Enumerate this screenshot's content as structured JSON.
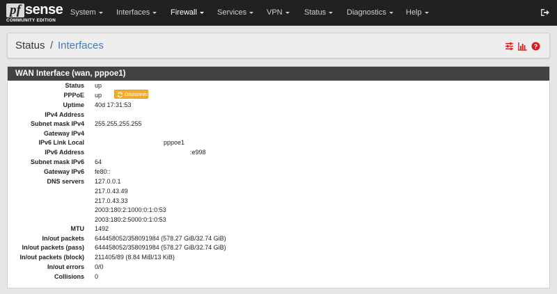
{
  "nav": {
    "logo_pf": "pf",
    "logo_sense": "sense",
    "logo_edition": "COMMUNITY EDITION",
    "items": [
      "System",
      "Interfaces",
      "Firewall",
      "Services",
      "VPN",
      "Status",
      "Diagnostics",
      "Help"
    ],
    "active_item": "Firewall"
  },
  "breadcrumb": {
    "parent": "Status",
    "separator": "/",
    "current": "Interfaces"
  },
  "panel": {
    "title": "WAN Interface (wan, pppoe1)",
    "disconnect_label": "Disconnect",
    "rows": [
      {
        "label": "Status",
        "values": [
          "up"
        ]
      },
      {
        "label": "PPPoE",
        "values": [
          "up"
        ]
      },
      {
        "label": "Uptime",
        "values": [
          "40d 17:31:53"
        ]
      },
      {
        "label": "IPv4 Address",
        "values": [
          ""
        ]
      },
      {
        "label": "Subnet mask IPv4",
        "values": [
          "255.255.255.255"
        ]
      },
      {
        "label": "Gateway IPv4",
        "values": [
          ""
        ]
      },
      {
        "label": "IPv6 Link Local",
        "values": [
          "pppoe1"
        ]
      },
      {
        "label": "IPv6 Address",
        "values": [
          ":e998"
        ]
      },
      {
        "label": "Subnet mask IPv6",
        "values": [
          "64"
        ]
      },
      {
        "label": "Gateway IPv6",
        "values": [
          "fe80::"
        ]
      },
      {
        "label": "DNS servers",
        "values": [
          "127.0.0.1",
          "217.0.43.49",
          "217.0.43.33",
          "2003:180:2:1000:0:1:0:53",
          "2003:180:2:5000:0:1:0:53"
        ]
      },
      {
        "label": "MTU",
        "values": [
          "1492"
        ]
      },
      {
        "label": "In/out packets",
        "values": [
          "644458052/358091984 (578.27 GiB/32.74 GiB)"
        ]
      },
      {
        "label": "In/out packets (pass)",
        "values": [
          "644458052/358091984 (578.27 GiB/32.74 GiB)"
        ]
      },
      {
        "label": "In/out packets (block)",
        "values": [
          "211405/89 (8.84 MiB/13 KiB)"
        ]
      },
      {
        "label": "In/out errors",
        "values": [
          "0/0"
        ]
      },
      {
        "label": "Collisions",
        "values": [
          "0"
        ]
      }
    ]
  },
  "icons": {
    "settings": "sliders-icon",
    "chart": "bar-chart-icon",
    "help": "question-circle-icon",
    "logout": "sign-out-icon",
    "refresh": "refresh-icon"
  },
  "colors": {
    "navbar": "#212121",
    "heading": "#424242",
    "link": "#3a7bc3",
    "tool_red": "#d11f1f",
    "button_warning": "#f0ad30"
  }
}
